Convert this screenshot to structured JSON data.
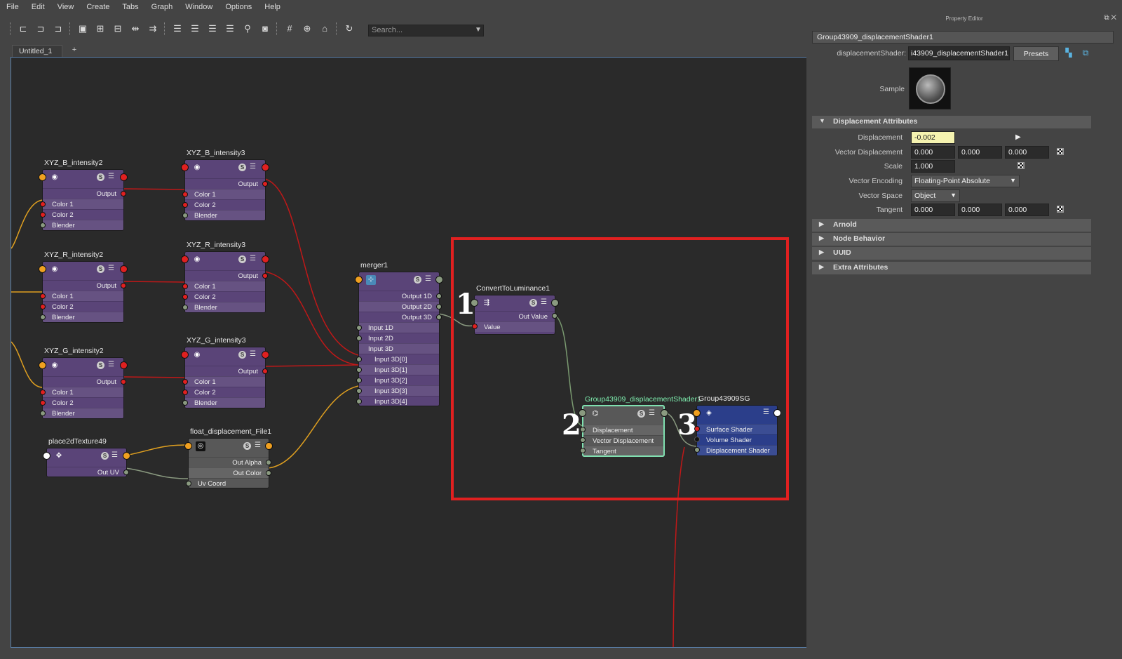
{
  "menu": [
    "File",
    "Edit",
    "View",
    "Create",
    "Tabs",
    "Graph",
    "Window",
    "Options",
    "Help"
  ],
  "toolbar": {
    "search_placeholder": "Search...",
    "icons": [
      "input-connections-icon",
      "io-connections-icon",
      "output-connections-icon",
      "clear-graph-icon",
      "add-selected-icon",
      "remove-selected-icon",
      "graph-layout-icon",
      "rearrange-icon",
      "simple-mode-icon",
      "connected-mode-icon",
      "full-mode-icon",
      "custom-mode-icon",
      "search-node-icon",
      "snapshot-icon",
      "grid-icon",
      "snap-icon",
      "camera-icon",
      "refresh-icon"
    ]
  },
  "tabs": {
    "active": "Untitled_1",
    "add": "+"
  },
  "graph": {
    "callouts": [
      "1",
      "2",
      "3"
    ],
    "nodes": {
      "xyz_b2": {
        "title": "XYZ_B_intensity2",
        "rows": [
          "Output",
          "Color 1",
          "Color 2",
          "Blender"
        ]
      },
      "xyz_b3": {
        "title": "XYZ_B_intensity3",
        "rows": [
          "Output",
          "Color 1",
          "Color 2",
          "Blender"
        ]
      },
      "xyz_r2": {
        "title": "XYZ_R_intensity2",
        "rows": [
          "Output",
          "Color 1",
          "Color 2",
          "Blender"
        ]
      },
      "xyz_r3": {
        "title": "XYZ_R_intensity3",
        "rows": [
          "Output",
          "Color 1",
          "Color 2",
          "Blender"
        ]
      },
      "xyz_g2": {
        "title": "XYZ_G_intensity2",
        "rows": [
          "Output",
          "Color 1",
          "Color 2",
          "Blender"
        ]
      },
      "xyz_g3": {
        "title": "XYZ_G_intensity3",
        "rows": [
          "Output",
          "Color 1",
          "Color 2",
          "Blender"
        ]
      },
      "place2d": {
        "title": "place2dTexture49",
        "rows": [
          "Out UV"
        ]
      },
      "file": {
        "title": "float_displacement_File1",
        "rows": [
          "Out Alpha",
          "Out Color",
          "Uv Coord"
        ]
      },
      "merger": {
        "title": "merger1",
        "rows": [
          "Output 1D",
          "Output 2D",
          "Output 3D",
          "Input 1D",
          "Input 2D",
          "Input 3D",
          "Input 3D[0]",
          "Input 3D[1]",
          "Input 3D[2]",
          "Input 3D[3]",
          "Input 3D[4]"
        ]
      },
      "lum": {
        "title": "ConvertToLuminance1",
        "rows": [
          "Out Value",
          "Value"
        ]
      },
      "disp": {
        "title": "Group43909_displacementShader1",
        "rows": [
          "Displacement",
          "Vector Displacement",
          "Tangent"
        ]
      },
      "sg": {
        "title": "Group43909SG",
        "rows": [
          "Surface Shader",
          "Volume Shader",
          "Displacement Shader"
        ]
      }
    }
  },
  "property_editor": {
    "title": "Property Editor",
    "node_tab": "Group43909_displacementShader1",
    "type_label": "displacementShader:",
    "type_value": "i43909_displacementShader1",
    "presets": "Presets",
    "sample_label": "Sample",
    "sections": {
      "displacement": "Displacement Attributes",
      "arnold": "Arnold",
      "node_behavior": "Node Behavior",
      "uuid": "UUID",
      "extra": "Extra Attributes"
    },
    "attrs": {
      "displacement_label": "Displacement",
      "displacement_value": "-0.002",
      "vector_displacement_label": "Vector Displacement",
      "vector_displacement": [
        "0.000",
        "0.000",
        "0.000"
      ],
      "scale_label": "Scale",
      "scale_value": "1.000",
      "vector_encoding_label": "Vector Encoding",
      "vector_encoding_value": "Floating-Point Absolute",
      "vector_space_label": "Vector Space",
      "vector_space_value": "Object",
      "tangent_label": "Tangent",
      "tangent": [
        "0.000",
        "0.000",
        "0.000"
      ]
    }
  }
}
